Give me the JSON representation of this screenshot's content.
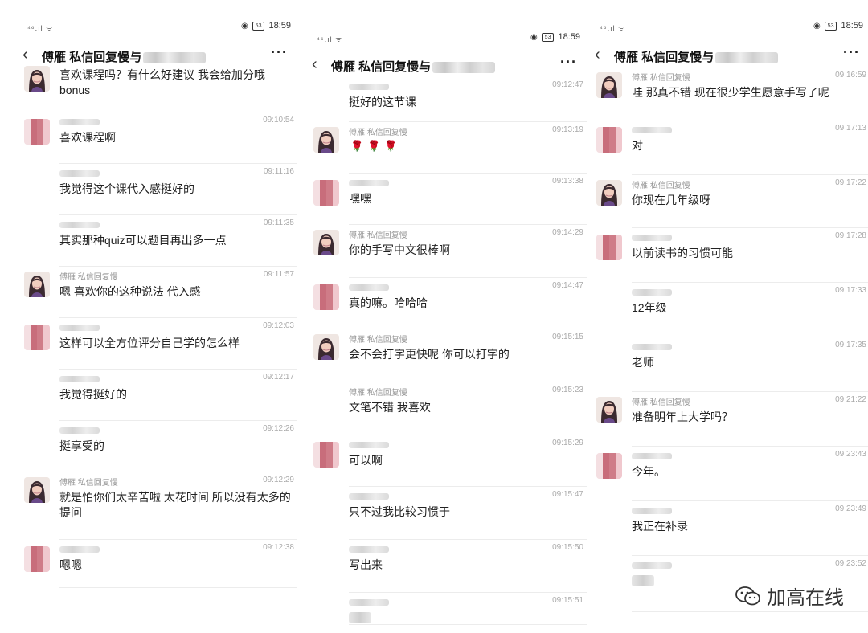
{
  "title_prefix": "傅雁 私信回复慢与",
  "status_time": "18:59",
  "status_signal": "⁴⁶.ıl ᯤ",
  "battery": "53",
  "watermark": "加高在线",
  "colors": {
    "time": "#aaaaaa",
    "name": "#999999",
    "divider": "#ececec",
    "rose": "#c62828"
  },
  "panels": [
    {
      "messages": [
        {
          "sender": "teacher",
          "name": "",
          "time": "",
          "text": "喜欢课程吗？有什么好建议 我会给加分哦bonus"
        },
        {
          "sender": "student",
          "name": "",
          "time": "09:10:54",
          "text": "喜欢课程啊"
        },
        {
          "sender": "student_cont",
          "name": "",
          "time": "09:11:16",
          "text": "我觉得这个课代入感挺好的"
        },
        {
          "sender": "student_cont",
          "name": "",
          "time": "09:11:35",
          "text": "其实那种quiz可以题目再出多一点"
        },
        {
          "sender": "teacher",
          "name": "傅雁 私信回复慢",
          "time": "09:11:57",
          "text": "嗯 喜欢你的这种说法 代入感"
        },
        {
          "sender": "student",
          "name": "",
          "time": "09:12:03",
          "text": "这样可以全方位评分自己学的怎么样"
        },
        {
          "sender": "student_cont",
          "name": "",
          "time": "09:12:17",
          "text": "我觉得挺好的"
        },
        {
          "sender": "student_cont",
          "name": "",
          "time": "09:12:26",
          "text": "挺享受的"
        },
        {
          "sender": "teacher",
          "name": "傅雁 私信回复慢",
          "time": "09:12:29",
          "text": "就是怕你们太辛苦啦 太花时间 所以没有太多的提问"
        },
        {
          "sender": "student",
          "name": "",
          "time": "09:12:38",
          "text": "嗯嗯"
        }
      ]
    },
    {
      "messages": [
        {
          "sender": "teacher_cont",
          "name": "",
          "time": "09:12:47",
          "text": "挺好的这节课"
        },
        {
          "sender": "teacher",
          "name": "傅雁 私信回复慢",
          "time": "09:13:19",
          "text": "",
          "roses": "🌹🌹🌹"
        },
        {
          "sender": "student",
          "name": "",
          "time": "09:13:38",
          "text": "嘿嘿"
        },
        {
          "sender": "teacher",
          "name": "傅雁 私信回复慢",
          "time": "09:14:29",
          "text": "你的手写中文很棒啊"
        },
        {
          "sender": "student",
          "name": "",
          "time": "09:14:47",
          "text": "真的嘛。哈哈哈"
        },
        {
          "sender": "teacher",
          "name": "傅雁 私信回复慢",
          "time": "09:15:15",
          "text": "会不会打字更快呢 你可以打字的"
        },
        {
          "sender": "teacher_cont",
          "name": "傅雁 私信回复慢",
          "time": "09:15:23",
          "text": "文笔不错 我喜欢"
        },
        {
          "sender": "student",
          "name": "",
          "time": "09:15:29",
          "text": "可以啊"
        },
        {
          "sender": "student_cont",
          "name": "",
          "time": "09:15:47",
          "text": "只不过我比较习惯于"
        },
        {
          "sender": "student_cont",
          "name": "",
          "time": "09:15:50",
          "text": "写出来"
        },
        {
          "sender": "student_cont",
          "name": "",
          "time": "09:15:51",
          "text": ""
        }
      ]
    },
    {
      "messages": [
        {
          "sender": "teacher",
          "name": "傅雁 私信回复慢",
          "time": "09:16:59",
          "text": "哇 那真不错 现在很少学生愿意手写了呢"
        },
        {
          "sender": "student",
          "name": "",
          "time": "09:17:13",
          "text": "对"
        },
        {
          "sender": "teacher",
          "name": "傅雁 私信回复慢",
          "time": "09:17:22",
          "text": "你现在几年级呀"
        },
        {
          "sender": "student",
          "name": "",
          "time": "09:17:28",
          "text": "以前读书的习惯可能"
        },
        {
          "sender": "student_cont",
          "name": "",
          "time": "09:17:33",
          "text": "12年级"
        },
        {
          "sender": "student_cont",
          "name": "",
          "time": "09:17:35",
          "text": "老师"
        },
        {
          "sender": "teacher",
          "name": "傅雁 私信回复慢",
          "time": "09:21:22",
          "text": "准备明年上大学吗？"
        },
        {
          "sender": "student",
          "name": "",
          "time": "09:23:43",
          "text": "今年。"
        },
        {
          "sender": "student_cont",
          "name": "",
          "time": "09:23:49",
          "text": "我正在补录"
        },
        {
          "sender": "student_cont",
          "name": "",
          "time": "09:23:52",
          "text": ""
        }
      ]
    }
  ]
}
